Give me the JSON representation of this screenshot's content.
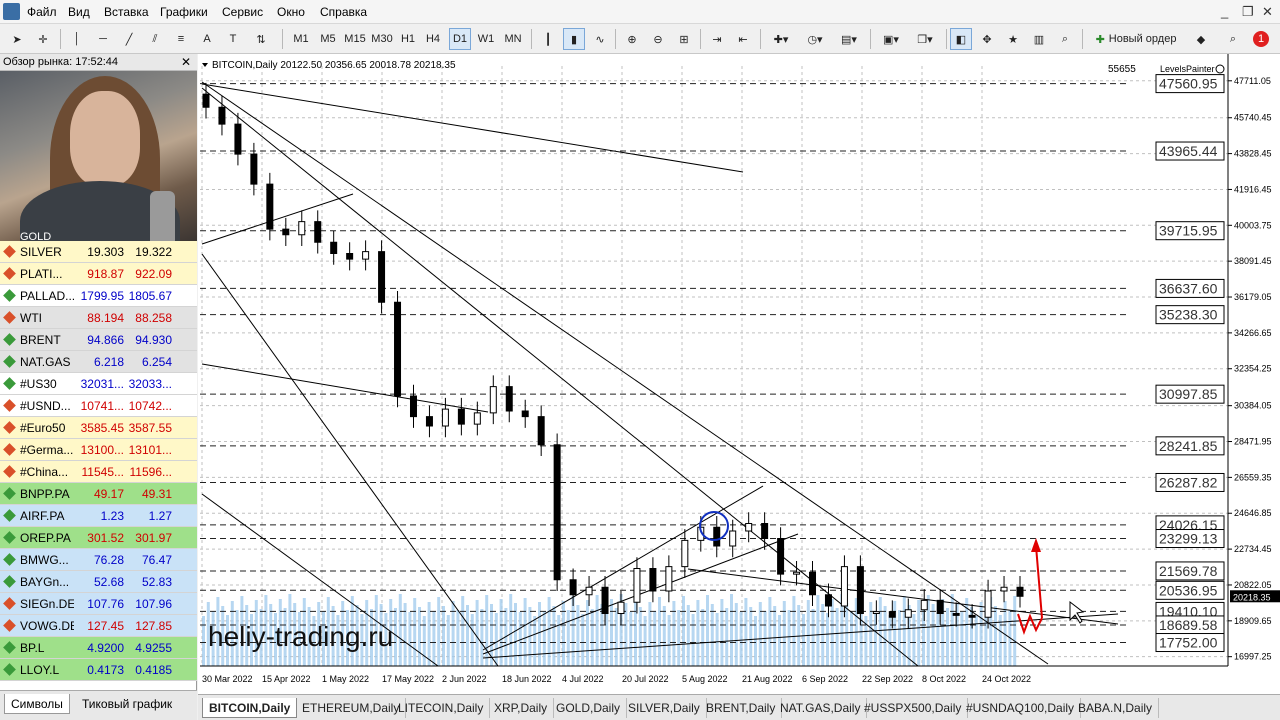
{
  "menu": [
    "Файл",
    "Вид",
    "Вставка",
    "Графики",
    "Сервис",
    "Окно",
    "Справка"
  ],
  "window_controls": [
    "_",
    "❐",
    "✕"
  ],
  "toolbar": {
    "timeframes": [
      "M1",
      "M5",
      "M15",
      "M30",
      "H1",
      "H4",
      "D1",
      "W1",
      "MN"
    ],
    "selected_timeframe": "D1",
    "new_order_label": "Новый ордер"
  },
  "market_watch": {
    "title": "Обзор рынка: 17:52:44",
    "partial_first": "GOLD",
    "rows": [
      {
        "name": "SILVER",
        "bid": "19.303",
        "ask": "19.322",
        "dir": "dn",
        "bg": "y",
        "color": ""
      },
      {
        "name": "PLATI...",
        "bid": "918.87",
        "ask": "922.09",
        "dir": "dn",
        "bg": "y",
        "color": "red"
      },
      {
        "name": "PALLAD...",
        "bid": "1799.95",
        "ask": "1805.67",
        "dir": "up",
        "bg": "w",
        "color": "blue"
      },
      {
        "name": "WTI",
        "bid": "88.194",
        "ask": "88.258",
        "dir": "dn",
        "bg": "g",
        "color": "red"
      },
      {
        "name": "BRENT",
        "bid": "94.866",
        "ask": "94.930",
        "dir": "up",
        "bg": "g",
        "color": "blue"
      },
      {
        "name": "NAT.GAS",
        "bid": "6.218",
        "ask": "6.254",
        "dir": "up",
        "bg": "g",
        "color": "blue"
      },
      {
        "name": "#US30",
        "bid": "32031...",
        "ask": "32033...",
        "dir": "up",
        "bg": "w",
        "color": "blue"
      },
      {
        "name": "#USND...",
        "bid": "10741...",
        "ask": "10742...",
        "dir": "dn",
        "bg": "w",
        "color": "red"
      },
      {
        "name": "#Euro50",
        "bid": "3585.45",
        "ask": "3587.55",
        "dir": "dn",
        "bg": "y",
        "color": "red"
      },
      {
        "name": "#Germa...",
        "bid": "13100...",
        "ask": "13101...",
        "dir": "dn",
        "bg": "y",
        "color": "red"
      },
      {
        "name": "#China...",
        "bid": "11545...",
        "ask": "11596...",
        "dir": "dn",
        "bg": "y",
        "color": "red"
      },
      {
        "name": "BNPP.PA",
        "bid": "49.17",
        "ask": "49.31",
        "dir": "up",
        "bg": "gr",
        "color": "red"
      },
      {
        "name": "AIRF.PA",
        "bid": "1.23",
        "ask": "1.27",
        "dir": "up",
        "bg": "b",
        "color": "blue"
      },
      {
        "name": "OREP.PA",
        "bid": "301.52",
        "ask": "301.97",
        "dir": "up",
        "bg": "gr",
        "color": "red"
      },
      {
        "name": "BMWG...",
        "bid": "76.28",
        "ask": "76.47",
        "dir": "up",
        "bg": "b",
        "color": "blue"
      },
      {
        "name": "BAYGn...",
        "bid": "52.68",
        "ask": "52.83",
        "dir": "up",
        "bg": "b",
        "color": "blue"
      },
      {
        "name": "SIEGn.DE",
        "bid": "107.76",
        "ask": "107.96",
        "dir": "dn",
        "bg": "b",
        "color": "blue"
      },
      {
        "name": "VOWG.DE",
        "bid": "127.45",
        "ask": "127.85",
        "dir": "dn",
        "bg": "b",
        "color": "red"
      },
      {
        "name": "BP.L",
        "bid": "4.9200",
        "ask": "4.9255",
        "dir": "up",
        "bg": "gr",
        "color": "blue"
      },
      {
        "name": "LLOY.L",
        "bid": "0.4173",
        "ask": "0.4185",
        "dir": "up",
        "bg": "gr",
        "color": "blue"
      }
    ],
    "tabs": [
      "Символы",
      "Тиковый график"
    ],
    "active_tab": "Символы"
  },
  "chart": {
    "header": "BITCOIN,Daily  20122.50 20356.65 20018.78 20218.35",
    "header_right": "55655",
    "indicator_label": "LevelsPainter",
    "watermark": "heliy-trading.ru",
    "current_price": "20218.35",
    "y_ticks": [
      "47711.05",
      "45740.45",
      "43828.45",
      "41916.45",
      "40003.75",
      "38091.45",
      "36179.05",
      "34266.65",
      "32354.25",
      "30384.05",
      "28471.95",
      "26559.35",
      "24646.85",
      "22734.45",
      "20822.05",
      "18909.65",
      "16997.25"
    ],
    "levels": [
      "47560.95",
      "43965.44",
      "39715.95",
      "36637.60",
      "35238.30",
      "30997.85",
      "28241.85",
      "26287.82",
      "24026.15",
      "23299.13",
      "21569.78",
      "20536.95",
      "19410.10",
      "18689.58",
      "17752.00"
    ],
    "x_labels": [
      "30 Mar 2022",
      "15 Apr 2022",
      "1 May 2022",
      "17 May 2022",
      "2 Jun 2022",
      "18 Jun 2022",
      "4 Jul 2022",
      "20 Jul 2022",
      "5 Aug 2022",
      "21 Aug 2022",
      "6 Sep 2022",
      "22 Sep 2022",
      "8 Oct 2022",
      "24 Oct 2022"
    ]
  },
  "chart_tabs": [
    "BITCOIN,Daily",
    "ETHEREUM,Daily",
    "LITECOIN,Daily",
    "XRP,Daily",
    "GOLD,Daily",
    "SILVER,Daily",
    "BRENT,Daily",
    "NAT.GAS,Daily",
    "#USSPX500,Daily",
    "#USNDAQ100,Daily",
    "BABA.N,Daily"
  ],
  "active_chart_tab": "BITCOIN,Daily",
  "chart_data": {
    "type": "candlestick",
    "series_close": [
      46300,
      45400,
      43800,
      42200,
      39800,
      39500,
      40200,
      39100,
      38500,
      38200,
      38600,
      35900,
      30900,
      29800,
      29300,
      30200,
      29400,
      30000,
      31400,
      30100,
      29800,
      28300,
      21100,
      20300,
      20700,
      19300,
      19900,
      21700,
      20500,
      21800,
      23200,
      23900,
      22900,
      23700,
      24100,
      23300,
      21400,
      21500,
      20300,
      19700,
      21800,
      19300,
      19400,
      19100,
      19500,
      20000,
      19300,
      19200,
      19100,
      20500,
      20700,
      20218
    ]
  }
}
